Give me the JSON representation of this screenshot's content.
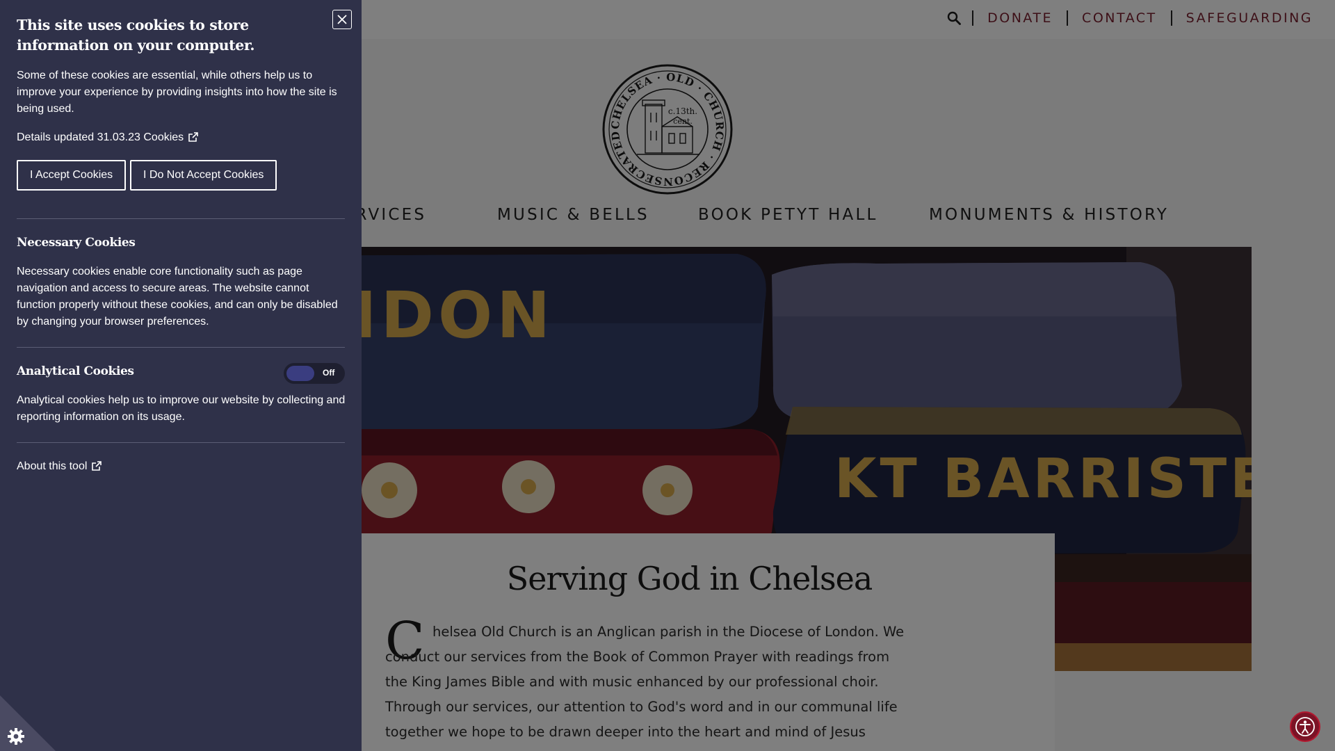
{
  "topbar": {
    "links": [
      "DONATE",
      "CONTACT",
      "SAFEGUARDING"
    ]
  },
  "logo": {
    "ring_text": "CHELSEA · OLD · CHURCH · RECONSECRATED AD 1958",
    "inner_text_1": "c.13th.",
    "inner_text_2": "cent."
  },
  "main_nav": {
    "items": [
      "SERVICES",
      "MUSIC & BELLS",
      "BOOK PETYT HALL",
      "MONUMENTS & HISTORY"
    ]
  },
  "hero": {
    "cushion_top": "OR LONDON",
    "cushion_right": "KT BARRISTER"
  },
  "content": {
    "heading": "Serving God in Chelsea",
    "dropcap": "C",
    "intro": "helsea Old Church is an Anglican parish in the Diocese of London. We conduct our services from the Book of Common Prayer with readings from the King James Bible and with music enhanced by our professional choir. Through our services, our attention to God's word and in our communal life together we hope to be drawn deeper into the heart and mind of Jesus Christ. We look forward to welcoming you"
  },
  "cookie_panel": {
    "title": "This site uses cookies to store information on your computer.",
    "intro": "Some of these cookies are essential, while others help us to improve your experience by providing insights into how the site is being used.",
    "details_label": "Details updated 31.03.23 Cookies",
    "accept_label": "I Accept Cookies",
    "reject_label": "I Do Not Accept Cookies",
    "necessary": {
      "heading": "Necessary Cookies",
      "text": "Necessary cookies enable core functionality such as page navigation and access to secure areas. The website cannot function properly without these cookies, and can only be disabled by changing your browser preferences."
    },
    "analytical": {
      "heading": "Analytical Cookies",
      "toggle_state": "Off",
      "text": "Analytical cookies help us to improve our website by collecting and reporting information on its usage."
    },
    "about_label": "About this tool"
  },
  "icons": {
    "search": "search-icon",
    "close": "close-icon",
    "external": "external-link-icon",
    "cookie_settings": "gear-icon",
    "accessibility": "accessibility-icon"
  },
  "colors": {
    "brand": "#7a1f2e",
    "panel_bg": "#2f3149",
    "toggle_knob": "#3a3d80",
    "a11y_button": "#7b1326"
  }
}
